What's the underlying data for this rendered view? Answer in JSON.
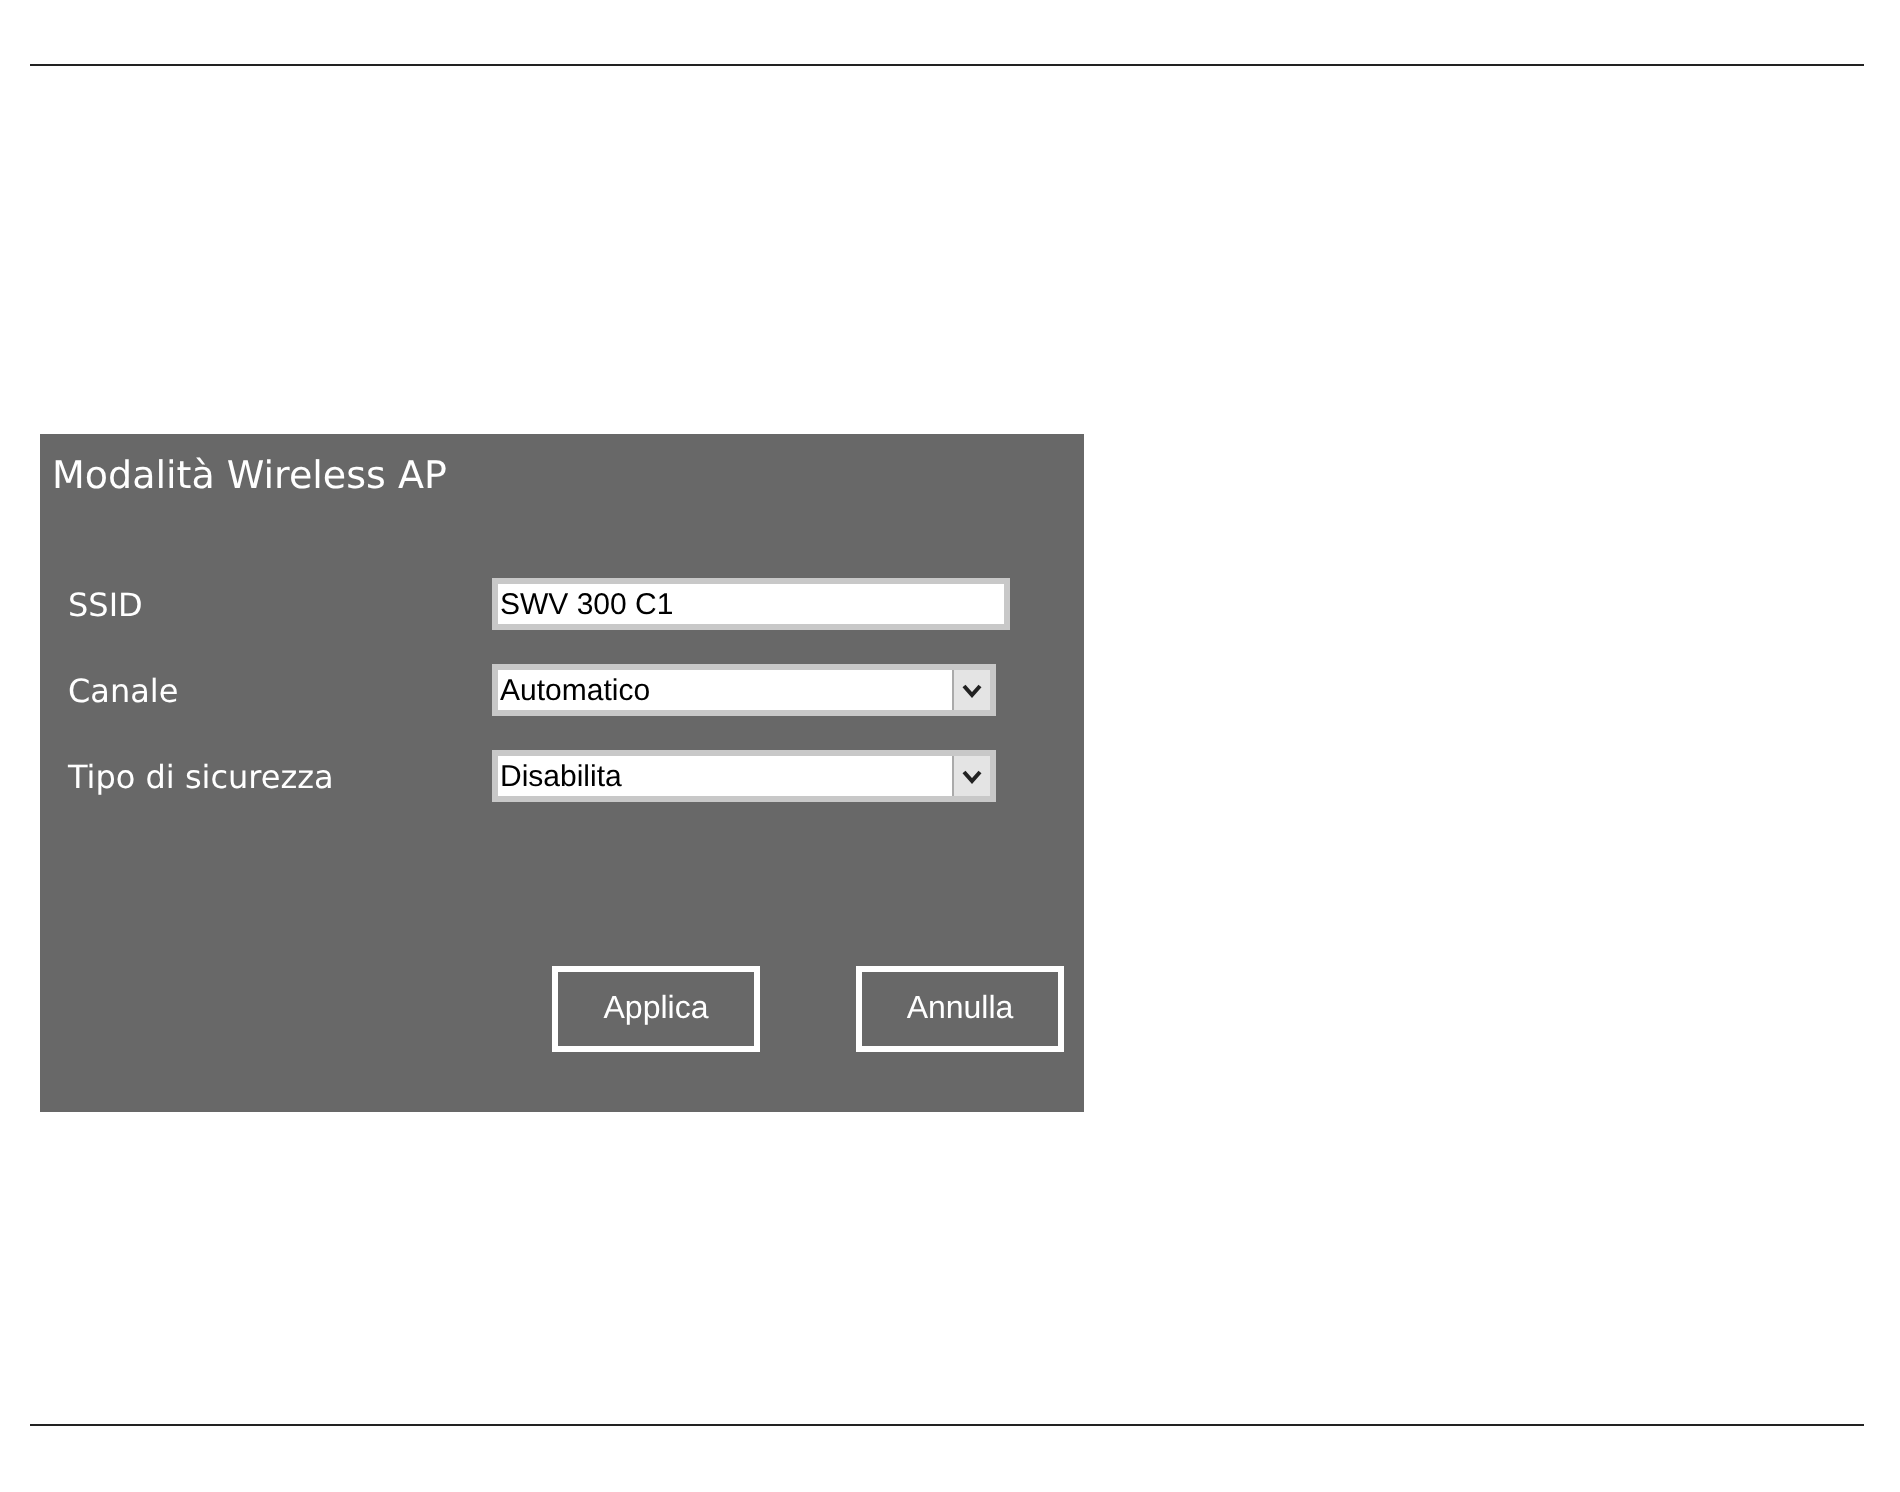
{
  "dialog": {
    "title": "Modalità Wireless AP",
    "fields": [
      {
        "kind": "text",
        "label": "SSID",
        "value": "SWV 300 C1"
      },
      {
        "kind": "select",
        "label": "Canale",
        "value": "Automatico"
      },
      {
        "kind": "select",
        "label": "Tipo di sicurezza",
        "value": "Disabilita"
      }
    ],
    "buttons": [
      "Applica",
      "Annulla"
    ]
  }
}
